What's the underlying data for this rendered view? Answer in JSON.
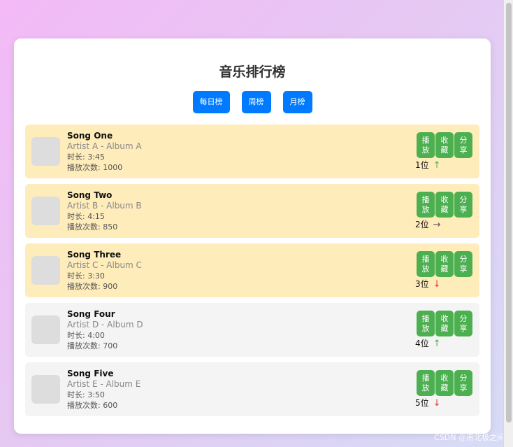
{
  "title": "音乐排行榜",
  "tabs": [
    {
      "label": "每日榜"
    },
    {
      "label": "周榜"
    },
    {
      "label": "月榜"
    }
  ],
  "actions": {
    "play": "播放",
    "favorite": "收藏",
    "share": "分享"
  },
  "songs": [
    {
      "name": "Song One",
      "artist_album": "Artist A - Album A",
      "duration": "时长: 3:45",
      "plays": "播放次数: 1000",
      "rank": "1位",
      "trend": "↑",
      "trend_color": "#4caf50",
      "highlight": true
    },
    {
      "name": "Song Two",
      "artist_album": "Artist B - Album B",
      "duration": "时长: 4:15",
      "plays": "播放次数: 850",
      "rank": "2位",
      "trend": "→",
      "trend_color": "#555555",
      "highlight": true
    },
    {
      "name": "Song Three",
      "artist_album": "Artist C - Album C",
      "duration": "时长: 3:30",
      "plays": "播放次数: 900",
      "rank": "3位",
      "trend": "↓",
      "trend_color": "#e53935",
      "highlight": true
    },
    {
      "name": "Song Four",
      "artist_album": "Artist D - Album D",
      "duration": "时长: 4:00",
      "plays": "播放次数: 700",
      "rank": "4位",
      "trend": "↑",
      "trend_color": "#4caf50",
      "highlight": false
    },
    {
      "name": "Song Five",
      "artist_album": "Artist E - Album E",
      "duration": "时长: 3:50",
      "plays": "播放次数: 600",
      "rank": "5位",
      "trend": "↓",
      "trend_color": "#e53935",
      "highlight": false
    }
  ],
  "watermark": "CSDN @南北极之间",
  "colors": {
    "tab_bg": "#007bff",
    "action_bg": "#4caf50",
    "top_row_bg": "#ffecbb",
    "normal_row_bg": "#f4f4f4"
  }
}
